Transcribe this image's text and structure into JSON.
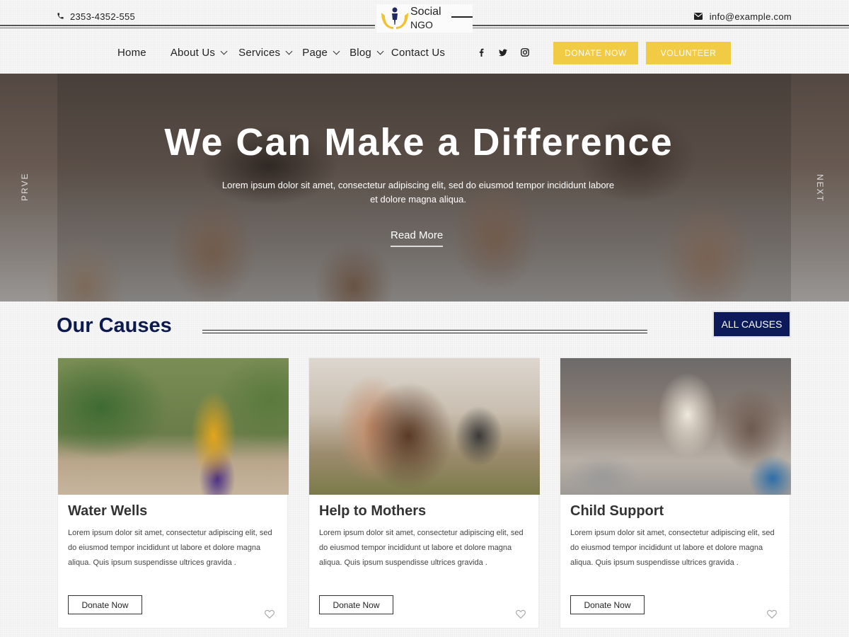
{
  "topbar": {
    "phone": "2353-4352-555",
    "email": "info@example.com",
    "logo_line1": "Social",
    "logo_line2": "NGO"
  },
  "nav": {
    "items": [
      {
        "label": "Home",
        "has_dropdown": false
      },
      {
        "label": "About Us",
        "has_dropdown": true
      },
      {
        "label": "Services",
        "has_dropdown": true
      },
      {
        "label": "Page",
        "has_dropdown": true
      },
      {
        "label": "Blog",
        "has_dropdown": true
      },
      {
        "label": "Contact Us",
        "has_dropdown": false
      }
    ],
    "social_icons": [
      "facebook-icon",
      "twitter-icon",
      "instagram-icon"
    ],
    "donate_label": "DONATE NOW",
    "volunteer_label": "VOLUNTEER"
  },
  "hero": {
    "title": "We Can Make a Difference",
    "subtitle": "Lorem ipsum dolor sit amet, consectetur adipiscing elit, sed do eiusmod tempor incididunt labore et dolore magna aliqua.",
    "read_more": "Read More",
    "prev_label": "PRVE",
    "next_label": "NEXT"
  },
  "causes": {
    "title": "Our Causes",
    "all_label": "ALL CAUSES",
    "cards": [
      {
        "title": "Water Wells",
        "text": "Lorem ipsum dolor sit amet, consectetur adipiscing elit, sed do eiusmod tempor incididunt ut labore et dolore magna aliqua. Quis ipsum suspendisse ultrices gravida .",
        "button": "Donate Now"
      },
      {
        "title": "Help to Mothers",
        "text": "Lorem ipsum dolor sit amet, consectetur adipiscing elit, sed do eiusmod tempor incididunt ut labore et dolore magna aliqua. Quis ipsum suspendisse ultrices gravida .",
        "button": "Donate Now"
      },
      {
        "title": "Child Support",
        "text": "Lorem ipsum dolor sit amet, consectetur adipiscing elit, sed do eiusmod tempor incididunt ut labore et dolore magna aliqua. Quis ipsum suspendisse ultrices gravida .",
        "button": "Donate Now"
      }
    ]
  },
  "colors": {
    "accent_yellow": "#f2cb45",
    "navy": "#0c1a5a",
    "title_navy": "#0c1a4e"
  }
}
